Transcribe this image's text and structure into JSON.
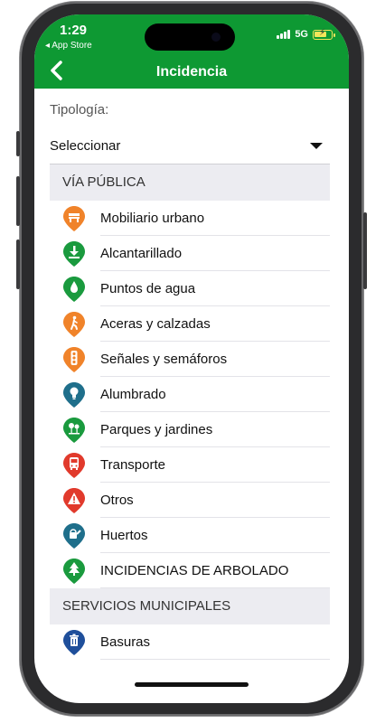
{
  "status_bar": {
    "time": "1:29",
    "back_app": "◂ App Store",
    "network": "5G",
    "battery_level": 0.75
  },
  "nav": {
    "title": "Incidencia"
  },
  "form": {
    "tipologia_label": "Tipología:",
    "selector_value": "Seleccionar"
  },
  "sections": [
    {
      "title": "VÍA PÚBLICA",
      "items": [
        {
          "label": "Mobiliario urbano",
          "icon": "bench-icon",
          "color": "#f0832a"
        },
        {
          "label": "Alcantarillado",
          "icon": "drain-icon",
          "color": "#1a9a3e"
        },
        {
          "label": "Puntos de agua",
          "icon": "water-drop-icon",
          "color": "#1a9a3e"
        },
        {
          "label": "Aceras y calzadas",
          "icon": "pedestrian-icon",
          "color": "#f0832a"
        },
        {
          "label": "Señales y semáforos",
          "icon": "traffic-light-icon",
          "color": "#f0832a"
        },
        {
          "label": "Alumbrado",
          "icon": "lightbulb-icon",
          "color": "#1f6f8b"
        },
        {
          "label": "Parques y jardines",
          "icon": "park-icon",
          "color": "#1a9a3e"
        },
        {
          "label": "Transporte",
          "icon": "bus-icon",
          "color": "#e13a2c"
        },
        {
          "label": "Otros",
          "icon": "warning-icon",
          "color": "#e13a2c"
        },
        {
          "label": "Huertos",
          "icon": "watering-can-icon",
          "color": "#1f6f8b"
        },
        {
          "label": "INCIDENCIAS DE ARBOLADO",
          "icon": "tree-icon",
          "color": "#1a9a3e"
        }
      ]
    },
    {
      "title": "SERVICIOS MUNICIPALES",
      "items": [
        {
          "label": "Basuras",
          "icon": "trash-icon",
          "color": "#1f4f9b"
        }
      ]
    }
  ]
}
